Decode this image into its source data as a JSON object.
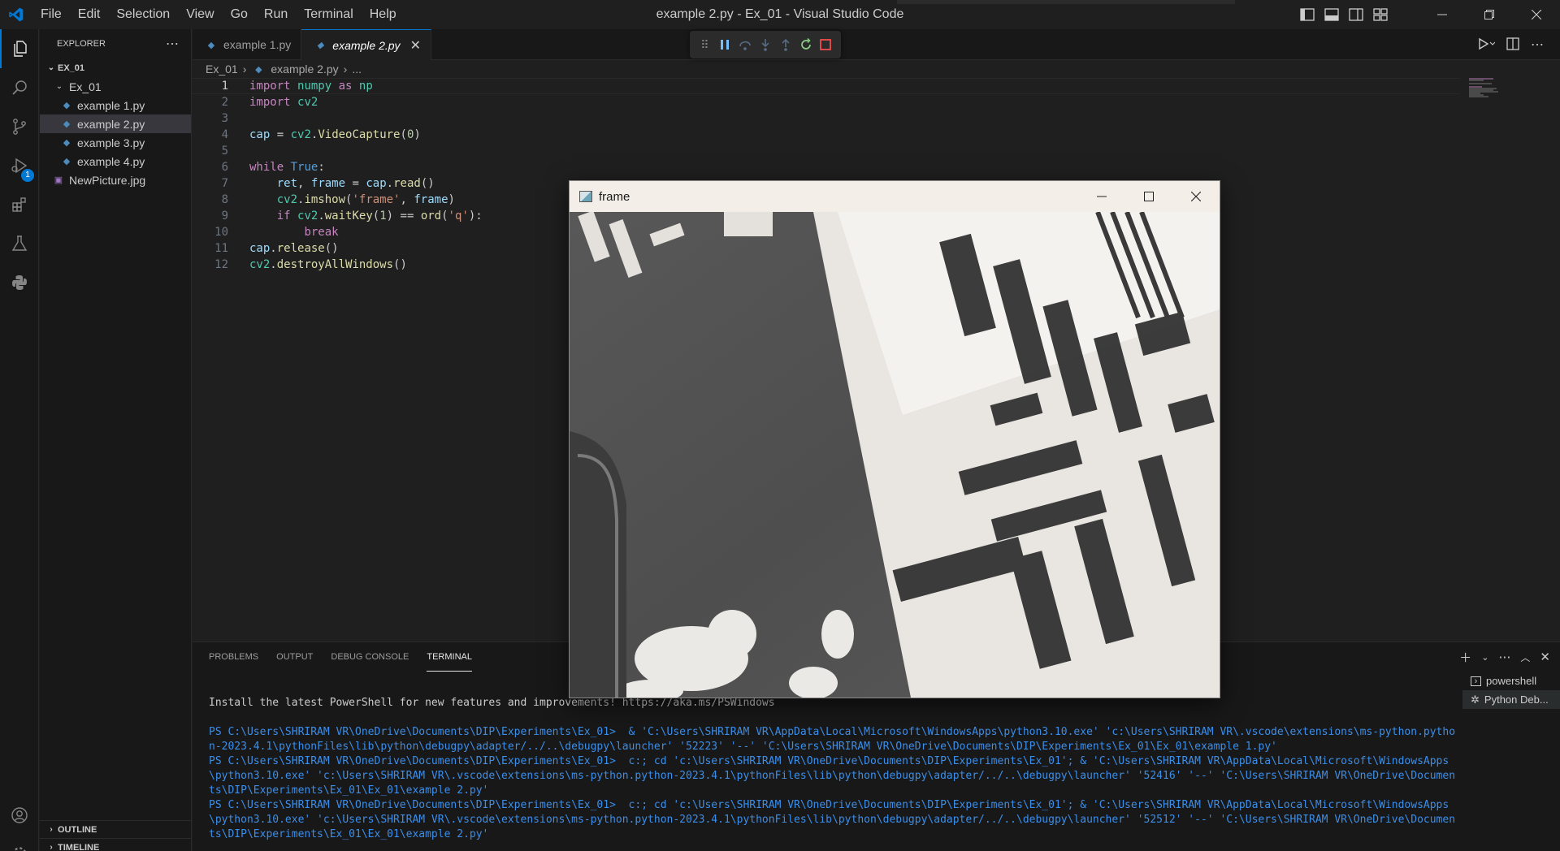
{
  "window": {
    "title": "example 2.py - Ex_01 - Visual Studio Code",
    "menu": [
      "File",
      "Edit",
      "Selection",
      "View",
      "Go",
      "Run",
      "Terminal",
      "Help"
    ]
  },
  "activity_bar": {
    "items": [
      "explorer-icon",
      "search-icon",
      "source-control-icon",
      "run-debug-icon",
      "extensions-icon",
      "testing-icon",
      "python-icon"
    ],
    "debug_badge": "1",
    "bottom": [
      "account-icon",
      "manage-gear-icon"
    ]
  },
  "sidebar": {
    "header": "EXPLORER",
    "workspace": "EX_01",
    "folder": "Ex_01",
    "files": [
      "example 1.py",
      "example 2.py",
      "example 3.py",
      "example 4.py"
    ],
    "selected_file": "example 2.py",
    "root_files": [
      "NewPicture.jpg"
    ],
    "outline_label": "OUTLINE",
    "timeline_label": "TIMELINE"
  },
  "editor": {
    "tabs": [
      {
        "label": "example 1.py",
        "active": false
      },
      {
        "label": "example 2.py",
        "active": true
      }
    ],
    "breadcrumb": {
      "folder": "Ex_01",
      "file": "example 2.py",
      "more": "..."
    },
    "current_line": 1,
    "lines": [
      "1",
      "2",
      "3",
      "4",
      "5",
      "6",
      "7",
      "8",
      "9",
      "10",
      "11",
      "12"
    ]
  },
  "panel": {
    "tabs": [
      "PROBLEMS",
      "OUTPUT",
      "DEBUG CONSOLE",
      "TERMINAL"
    ],
    "active_tab": "TERMINAL",
    "terminal_lines": [
      "Install the latest PowerShell for new features and improvements! https://aka.ms/PSWindows",
      "PS C:\\Users\\SHRIRAM VR\\OneDrive\\Documents\\DIP\\Experiments\\Ex_01>  & 'C:\\Users\\SHRIRAM VR\\AppData\\Local\\Microsoft\\WindowsApps\\python3.10.exe' 'c:\\Users\\SHRIRAM VR\\.vscode\\extensions\\ms-python.python-2023.4.1\\pythonFiles\\lib\\python\\debugpy\\adapter/../..\\debugpy\\launcher' '52223' '--' 'C:\\Users\\SHRIRAM VR\\OneDrive\\Documents\\DIP\\Experiments\\Ex_01\\Ex_01\\example 1.py'",
      "PS C:\\Users\\SHRIRAM VR\\OneDrive\\Documents\\DIP\\Experiments\\Ex_01>  c:; cd 'c:\\Users\\SHRIRAM VR\\OneDrive\\Documents\\DIP\\Experiments\\Ex_01'; & 'C:\\Users\\SHRIRAM VR\\AppData\\Local\\Microsoft\\WindowsApps\\python3.10.exe' 'c:\\Users\\SHRIRAM VR\\.vscode\\extensions\\ms-python.python-2023.4.1\\pythonFiles\\lib\\python\\debugpy\\adapter/../..\\debugpy\\launcher' '52416' '--' 'C:\\Users\\SHRIRAM VR\\OneDrive\\Documents\\DIP\\Experiments\\Ex_01\\Ex_01\\example 2.py'",
      "PS C:\\Users\\SHRIRAM VR\\OneDrive\\Documents\\DIP\\Experiments\\Ex_01>  c:; cd 'c:\\Users\\SHRIRAM VR\\OneDrive\\Documents\\DIP\\Experiments\\Ex_01'; & 'C:\\Users\\SHRIRAM VR\\AppData\\Local\\Microsoft\\WindowsApps\\python3.10.exe' 'c:\\Users\\SHRIRAM VR\\.vscode\\extensions\\ms-python.python-2023.4.1\\pythonFiles\\lib\\python\\debugpy\\adapter/../..\\debugpy\\launcher' '52512' '--' 'C:\\Users\\SHRIRAM VR\\OneDrive\\Documents\\DIP\\Experiments\\Ex_01\\Ex_01\\example 2.py'"
    ],
    "terminals": [
      "powershell",
      "Python Deb..."
    ]
  },
  "frame_window": {
    "title": "frame"
  },
  "colors": {
    "accent": "#0078d4",
    "editor_bg": "#1f1f1f",
    "sidebar_bg": "#181818",
    "stop_red": "#f14c4c",
    "continue_blue": "#75beff",
    "restart_green": "#89d185"
  }
}
